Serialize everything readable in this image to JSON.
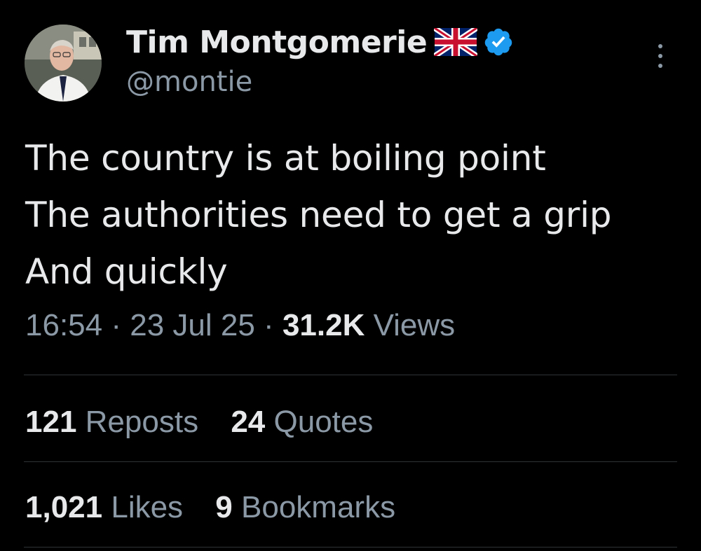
{
  "author": {
    "display_name": "Tim Montgomerie",
    "handle": "@montie",
    "flag_icon": "union-jack-flag-icon",
    "verified_icon": "verified-badge-icon",
    "verified_color": "#1d9bf0"
  },
  "more_icon": "more-vertical-icon",
  "tweet": {
    "lines": [
      "The country is at boiling point",
      "The authorities need to get a grip",
      "And quickly"
    ]
  },
  "meta": {
    "time": "16:54",
    "dot1": "·",
    "date": "23 Jul 25",
    "dot2": "·",
    "views_count": "31.2K",
    "views_label": "Views"
  },
  "stats": {
    "reposts_count": "121",
    "reposts_label": "Reposts",
    "quotes_count": "24",
    "quotes_label": "Quotes",
    "likes_count": "1,021",
    "likes_label": "Likes",
    "bookmarks_count": "9",
    "bookmarks_label": "Bookmarks"
  },
  "colors": {
    "background": "#000000",
    "primary_text": "#e7e9ea",
    "secondary_text": "#8b98a5",
    "divider": "#2f3336"
  }
}
